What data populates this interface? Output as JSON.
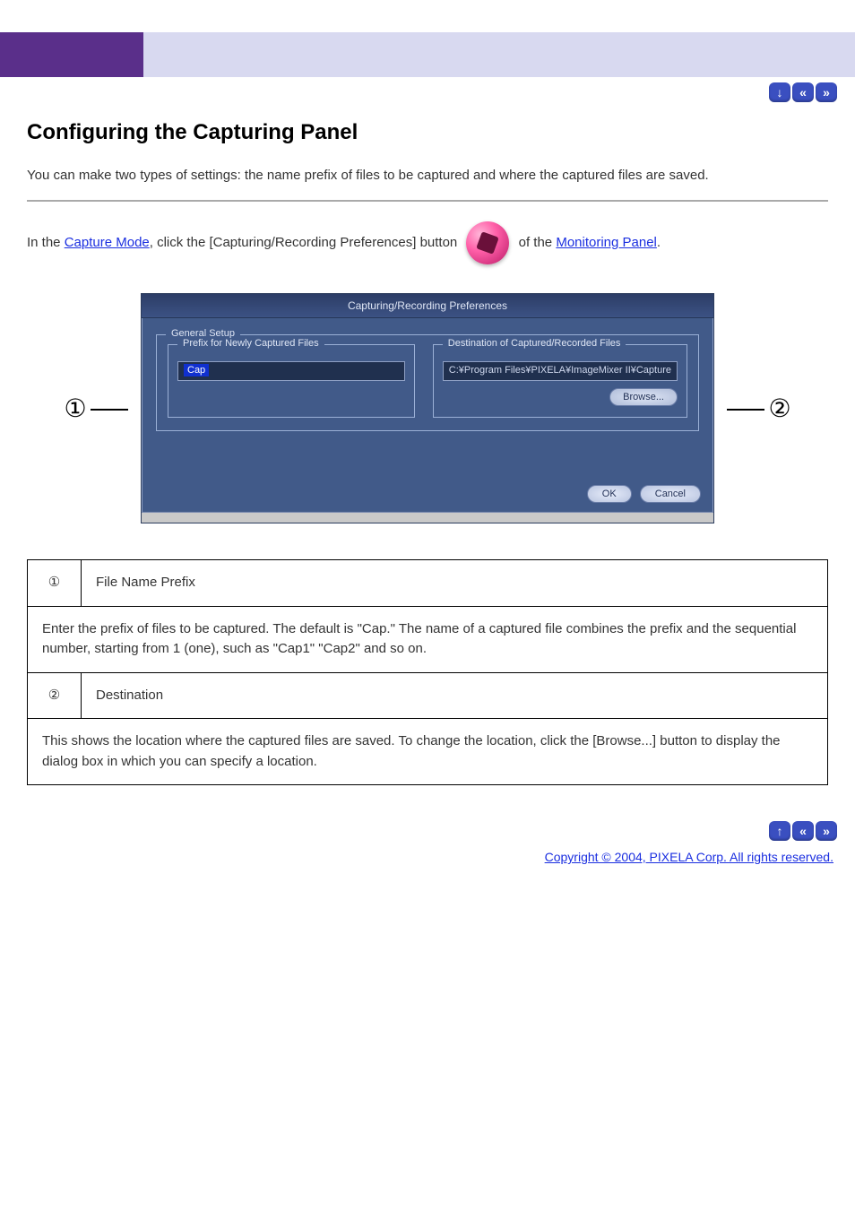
{
  "header": {
    "left": "",
    "right": ""
  },
  "nav": {
    "down_title": "Down",
    "prev_title": "Previous",
    "next_title": "Next",
    "up_title": "Up"
  },
  "title": "Configuring the Capturing Panel",
  "lead": "You can make two types of settings: the name prefix of files to be captured and where the captured files are saved.",
  "intro": {
    "part1": "In the ",
    "link1": "Capture Mode",
    "part2": ", click the [Capturing/Recording Preferences] button ",
    "part3": " of the ",
    "link2": "Monitoring Panel",
    "part4": "."
  },
  "screenshot": {
    "window_title": "Capturing/Recording Preferences",
    "general_label": "General Setup",
    "prefix_label": "Prefix for Newly Captured Files",
    "prefix_value": "Cap",
    "dest_label": "Destination of Captured/Recorded Files",
    "dest_value": "C:¥Program Files¥PIXELA¥ImageMixer II¥Capture",
    "browse": "Browse...",
    "ok": "OK",
    "cancel": "Cancel"
  },
  "callouts": {
    "n1": "①",
    "n2": "②"
  },
  "table": {
    "r1_title": "File Name Prefix",
    "r1_desc": "Enter the prefix of files to be captured. The default is \"Cap.\" The name of a captured file combines the prefix and the sequential number, starting from 1 (one), such as \"Cap1\" \"Cap2\" and so on.",
    "r2_title": "Destination",
    "r2_desc": "This shows the location where the captured files are saved. To change the location, click the [Browse...] button to display the dialog box in which you can specify a location."
  },
  "copyright": "Copyright © 2004, PIXELA Corp. All rights reserved."
}
